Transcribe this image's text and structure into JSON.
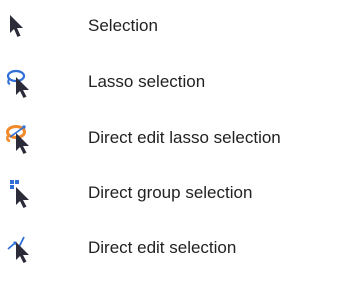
{
  "tools": [
    {
      "label": "Selection",
      "icon": "selection-arrow-icon"
    },
    {
      "label": "Lasso selection",
      "icon": "lasso-selection-icon"
    },
    {
      "label": "Direct edit lasso selection",
      "icon": "direct-edit-lasso-selection-icon"
    },
    {
      "label": "Direct group selection",
      "icon": "direct-group-selection-icon"
    },
    {
      "label": "Direct edit selection",
      "icon": "direct-edit-selection-icon"
    }
  ],
  "colors": {
    "arrow": "#2b2b3a",
    "blue": "#2f6fd6",
    "orange": "#f08a2a",
    "text": "#222222"
  }
}
